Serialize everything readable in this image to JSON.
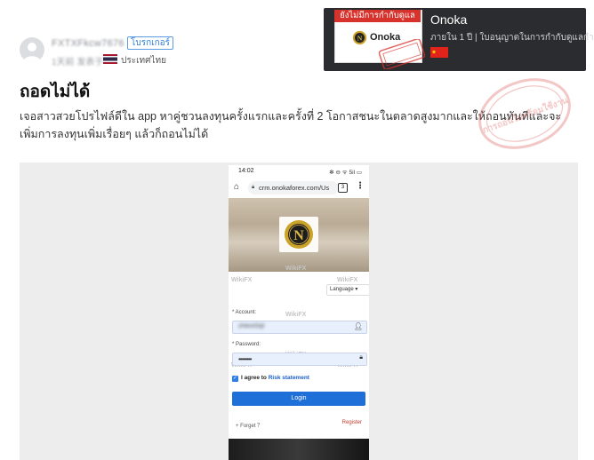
{
  "post": {
    "username": "FXTXFkcw7676",
    "role_badge": "โบรกเกอร์",
    "meta_time": "1天前 发表于",
    "country": "ประเทศไทย",
    "title": "ถอดไม่ได้",
    "body": "เจอสาวสวยโปรไฟล์ดีใน app หาคู่ชวนลงทุนครั้งแรกและครั้งที่ 2 โอกาสชนะในตลาดสูงมากและให้ถอนทันทีและจะเพิ่มการลงทุนเพิ่มเรื่อยๆ แล้วก็ถอนไม่ได้"
  },
  "broker": {
    "status_label": "ยังไม่มีการกำกับดูแล",
    "logo_text": "Onoka",
    "name": "Onoka",
    "subtitle": "ภายใน 1 ปี | ใบอนุญาตในการกำกับดูแลกำ...",
    "flag_color": "#e0241b"
  },
  "stamp": {
    "text": "การถอนไม่พร้อมใช้งาน",
    "color": "#d9534f"
  },
  "phone": {
    "time": "14:02",
    "status_icons": "✻ ⊖ ᯤ 5il ▭",
    "url": "crm.onokaforex.com/Us",
    "tab_count": "3",
    "watermark": "WikiFX",
    "language": "Language",
    "account_label": "* Account:",
    "account_value": "zhtest3@",
    "password_label": "* Password:",
    "password_value": "••••••••",
    "agree_text": "I agree to",
    "risk_link": "Risk statement",
    "login_label": "Login",
    "forget_label": "+ Forget ？",
    "register_label": "Register"
  },
  "colors": {
    "accent": "#1f6fd8",
    "danger": "#d8322c",
    "badge_blue": "#2f7fd6"
  }
}
